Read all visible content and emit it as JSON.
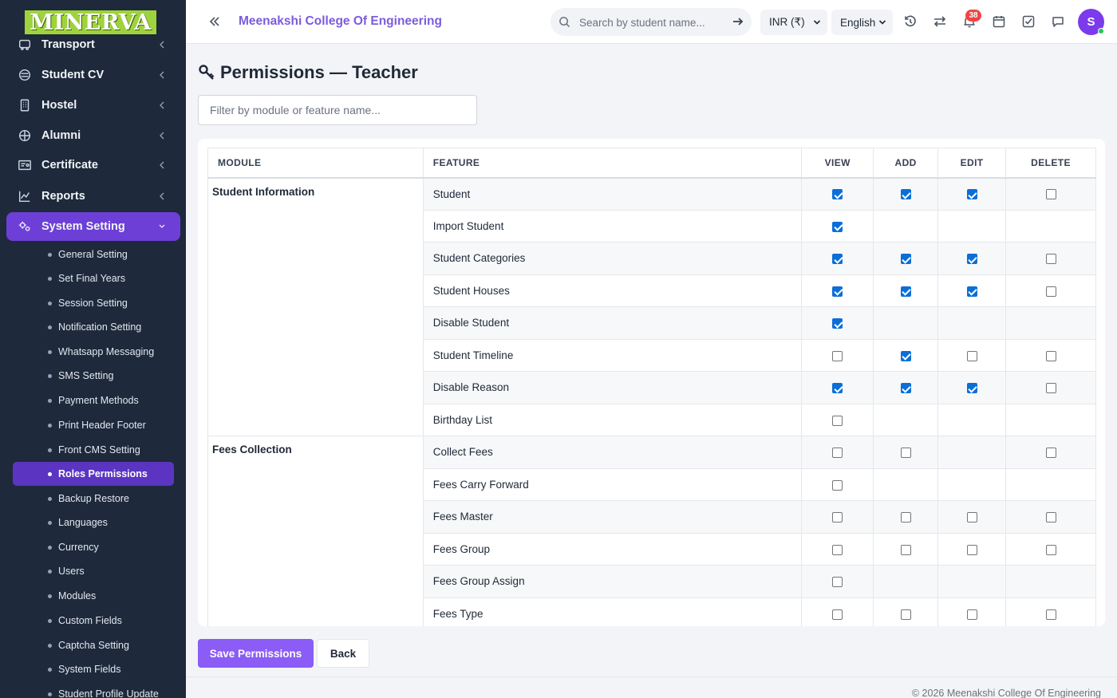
{
  "brand": {
    "logo_text": "MINERVA"
  },
  "sidebar": {
    "menu": [
      {
        "label": "Transport",
        "icon": "bus-icon"
      },
      {
        "label": "Student CV",
        "icon": "cv-icon"
      },
      {
        "label": "Hostel",
        "icon": "building-icon"
      },
      {
        "label": "Alumni",
        "icon": "globe-icon"
      },
      {
        "label": "Certificate",
        "icon": "certificate-icon"
      },
      {
        "label": "Reports",
        "icon": "chart-line-icon"
      },
      {
        "label": "System Setting",
        "icon": "gears-icon"
      }
    ],
    "submenu": [
      "General Setting",
      "Set Final Years",
      "Session Setting",
      "Notification Setting",
      "Whatsapp Messaging",
      "SMS Setting",
      "Payment Methods",
      "Print Header Footer",
      "Front CMS Setting",
      "Roles Permissions",
      "Backup Restore",
      "Languages",
      "Currency",
      "Users",
      "Modules",
      "Custom Fields",
      "Captcha Setting",
      "System Fields",
      "Student Profile Update"
    ],
    "active_submenu": "Roles Permissions"
  },
  "topbar": {
    "college": "Meenakshi College Of Engineering",
    "search_placeholder": "Search by student name...",
    "currency": "INR (₹)",
    "language": "English",
    "notification_count": "38",
    "avatar_initial": "S"
  },
  "page": {
    "title": "Permissions — Teacher",
    "filter_placeholder": "Filter by module or feature name..."
  },
  "table": {
    "headers": {
      "module": "MODULE",
      "feature": "FEATURE",
      "view": "VIEW",
      "add": "ADD",
      "edit": "EDIT",
      "delete": "DELETE"
    },
    "groups": [
      {
        "module": "Student Information",
        "rows": [
          {
            "feature": "Student",
            "view": true,
            "add": true,
            "edit": true,
            "delete": false
          },
          {
            "feature": "Import Student",
            "view": true,
            "add": null,
            "edit": null,
            "delete": null
          },
          {
            "feature": "Student Categories",
            "view": true,
            "add": true,
            "edit": true,
            "delete": false
          },
          {
            "feature": "Student Houses",
            "view": true,
            "add": true,
            "edit": true,
            "delete": false
          },
          {
            "feature": "Disable Student",
            "view": true,
            "add": null,
            "edit": null,
            "delete": null
          },
          {
            "feature": "Student Timeline",
            "view": false,
            "add": true,
            "edit": false,
            "delete": false
          },
          {
            "feature": "Disable Reason",
            "view": true,
            "add": true,
            "edit": true,
            "delete": false
          },
          {
            "feature": "Birthday List",
            "view": false,
            "add": null,
            "edit": null,
            "delete": null
          }
        ]
      },
      {
        "module": "Fees Collection",
        "rows": [
          {
            "feature": "Collect Fees",
            "view": false,
            "add": false,
            "edit": null,
            "delete": false
          },
          {
            "feature": "Fees Carry Forward",
            "view": false,
            "add": null,
            "edit": null,
            "delete": null
          },
          {
            "feature": "Fees Master",
            "view": false,
            "add": false,
            "edit": false,
            "delete": false
          },
          {
            "feature": "Fees Group",
            "view": false,
            "add": false,
            "edit": false,
            "delete": false
          },
          {
            "feature": "Fees Group Assign",
            "view": false,
            "add": null,
            "edit": null,
            "delete": null
          },
          {
            "feature": "Fees Type",
            "view": false,
            "add": false,
            "edit": false,
            "delete": false
          }
        ]
      }
    ]
  },
  "actions": {
    "save": "Save Permissions",
    "back": "Back"
  },
  "footer": {
    "text": "© 2026 Meenakshi College Of Engineering"
  },
  "colors": {
    "accent": "#8b5cf6",
    "sidebar_bg": "#1e293b",
    "sidebar_active": "#6d3fd6",
    "checkbox_on": "#0b6fd8",
    "badge": "#ef4444"
  }
}
